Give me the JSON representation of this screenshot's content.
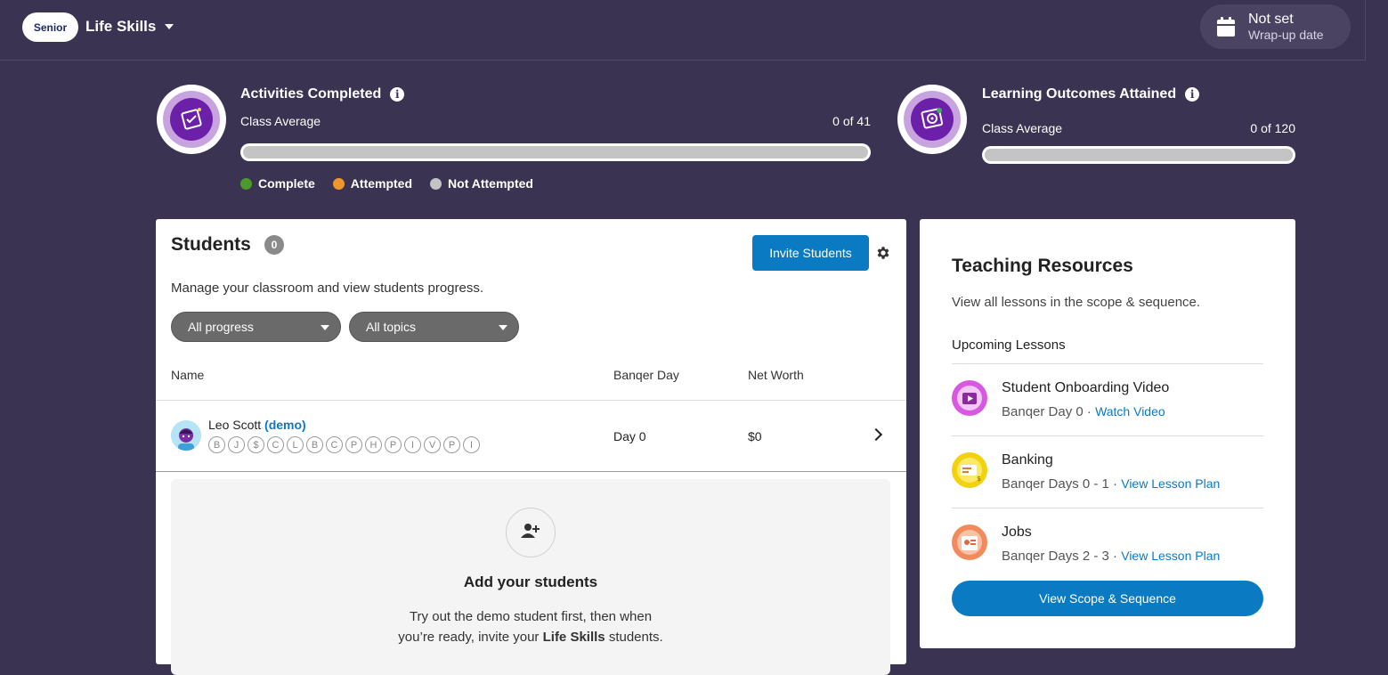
{
  "header": {
    "level_badge": "Senior",
    "course": "Life Skills",
    "wrapup_title": "Not set",
    "wrapup_sub": "Wrap-up date"
  },
  "activities": {
    "title": "Activities Completed",
    "sub": "Class Average",
    "value": "0 of 41",
    "progress": 0
  },
  "outcomes": {
    "title": "Learning Outcomes Attained",
    "sub": "Class Average",
    "value": "0 of 120",
    "progress": 0
  },
  "legend": [
    {
      "label": "Complete",
      "color": "#4c9a2a"
    },
    {
      "label": "Attempted",
      "color": "#f0962a"
    },
    {
      "label": "Not Attempted",
      "color": "#c4c4c4"
    }
  ],
  "students": {
    "title": "Students",
    "count": "0",
    "invite_label": "Invite Students",
    "description": "Manage your classroom and view students progress.",
    "filter_progress": "All progress",
    "filter_topics": "All topics",
    "columns": {
      "name": "Name",
      "day": "Banqer Day",
      "worth": "Net Worth"
    },
    "rows": [
      {
        "name": "Leo Scott",
        "tag": "(demo)",
        "chips": [
          "B",
          "J",
          "$",
          "C",
          "L",
          "B",
          "C",
          "P",
          "H",
          "P",
          "I",
          "V",
          "P",
          "I"
        ],
        "day": "Day 0",
        "worth": "$0"
      }
    ],
    "add": {
      "title": "Add your students",
      "line1": "Try out the demo student first, then when",
      "line2_pre": "you’re ready, invite your",
      "line2_bold": "Life Skills",
      "line2_post": "students."
    }
  },
  "teaching": {
    "title": "Teaching Resources",
    "description": "View all lessons in the scope & sequence.",
    "upcoming": "Upcoming Lessons",
    "lessons": [
      {
        "name": "Student Onboarding Video",
        "meta": "Banqer Day 0 ·",
        "link": "Watch Video",
        "icon_color": "#d659e0"
      },
      {
        "name": "Banking",
        "meta": "Banqer Days 0 - 1 ·",
        "link": "View Lesson Plan",
        "icon_color": "#f2d20f"
      },
      {
        "name": "Jobs",
        "meta": "Banqer Days 2 - 3 ·",
        "link": "View Lesson Plan",
        "icon_color": "#f28a5c"
      }
    ],
    "scope_label": "View Scope & Sequence"
  }
}
